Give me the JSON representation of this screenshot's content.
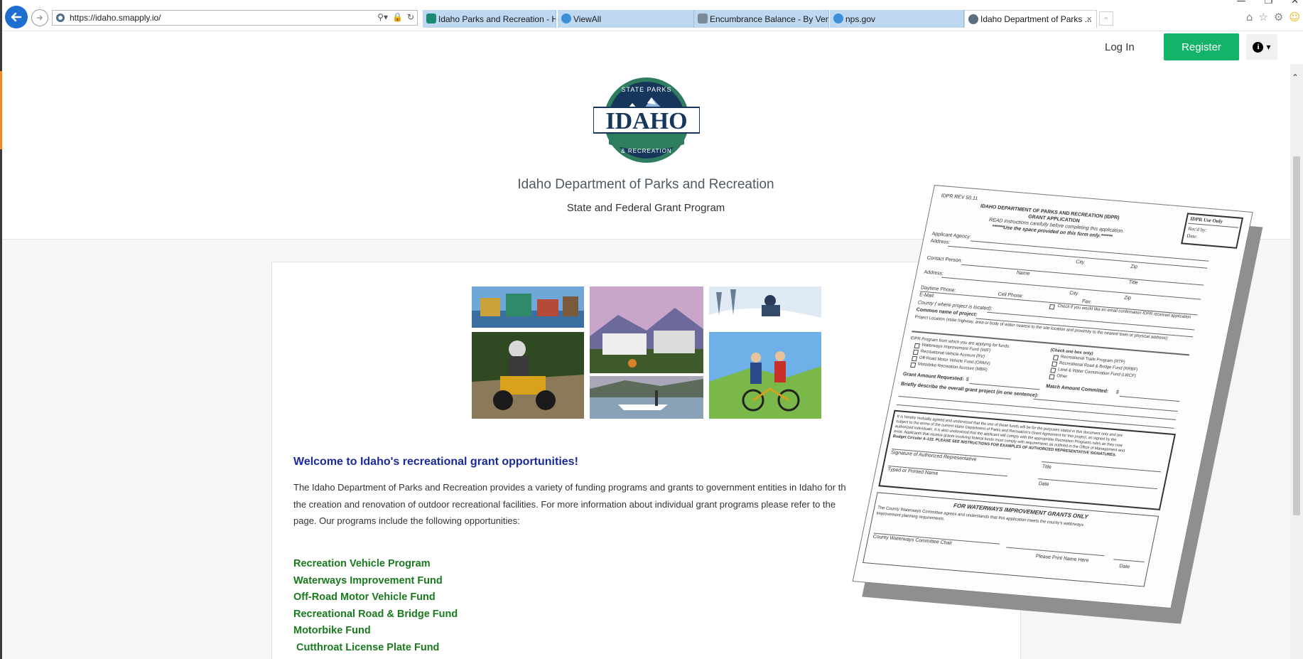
{
  "browser": {
    "url": "https://idaho.smapply.io/",
    "tabs": [
      {
        "label": "Idaho Parks and Recreation - H...",
        "icon": "sharepoint-icon"
      },
      {
        "label": "ViewAll",
        "icon": "ie-icon"
      },
      {
        "label": "Encumbrance Balance - By Ven...",
        "icon": "report-icon"
      },
      {
        "label": "nps.gov",
        "icon": "ie-icon"
      },
      {
        "label": "Idaho Department of Parks ...",
        "icon": "smapply-icon",
        "active": true
      }
    ],
    "close_glyph": "×"
  },
  "header": {
    "login_label": "Log In",
    "register_label": "Register",
    "info_glyph": "i"
  },
  "org": {
    "logo_text": "IDAHO",
    "logo_top_ring": "STATE PARKS",
    "logo_bottom_ring": "& RECREATION",
    "title": "Idaho Department of Parks and Recreation",
    "subtitle": "State and Federal Grant Program"
  },
  "content": {
    "welcome": "Welcome to Idaho's recreational grant opportunities!",
    "intro_line1": "The Idaho Department of Parks and Recreation provides a variety of funding programs and grants to government entities in Idaho for th",
    "intro_line2": "the creation and renovation of outdoor recreational facilities. For more information about individual grant programs please refer to the",
    "intro_line3": "page. Our programs include the following opportunities:",
    "programs": [
      "Recreation Vehicle Program",
      "Waterways Improvement Fund",
      "Off-Road Motor Vehicle Fund",
      "Recreational Road & Bridge Fund",
      "Motorbike Fund",
      "Cutthroat License Plate Fund"
    ]
  },
  "form": {
    "rev": "IDPR REV 50.11",
    "title": "IDAHO DEPARTMENT OF PARKS AND RECREATION (IDPR)",
    "subtitle": "GRANT APPLICATION",
    "read_note": "READ instructions carefully before completing this application.",
    "space_note": "******Use the space provided on this form only.******",
    "use_only": "IDPR Use Only",
    "recd_by": "Rec'd by:",
    "date_short": "Date:",
    "applicant_agency": "Applicant Agency:",
    "address": "Address:",
    "city": "City",
    "zip": "Zip",
    "contact_person": "Contact Person:",
    "name": "Name",
    "title_lbl": "Title",
    "daytime_phone": "Daytime Phone:",
    "cell_phone": "Cell Phone:",
    "fax": "Fax:",
    "email": "E-Mail:",
    "email_check": "Check if you would like an email confirmation IDPR received application",
    "county": "County ( where project is located):",
    "common_name": "Common name of project:",
    "project_location": "Project Location (state highway, area or body of water nearest to the site location and proximity to the nearest town or physical address):",
    "program_header": "IDPR Program from which you are applying for funds:",
    "check_one": "(Check one box only)",
    "left_programs": [
      "Waterways Improvement Fund (WIF)",
      "Recreational Vehicle Account (RV)",
      "Off-Road Motor Vehicle Fund (ORMV)",
      "Motorbike Recreation Account (MBR)"
    ],
    "right_programs": [
      "Recreational Trails Program (RTP)",
      "Recreational Road & Bridge Fund (RRBF)",
      "Land & Water Conservation Fund (LWCF)",
      "Other"
    ],
    "grant_requested": "Grant Amount Requested:",
    "match_committed": "Match Amount Committed:",
    "dollar": "$",
    "briefly": "Briefly describe the overall grant project (in one sentence):",
    "agreement_1": "It is hereby mutually agreed and understood that the use of these funds will be for the purposes stated in this document only and are",
    "agreement_2": "subject to the terms of the current Idaho Department of Parks and Recreation's Grant Agreement for this project, as signed by the",
    "agreement_3": "authorized individuals. It is also understood that the applicant will comply with the appropriate Recreation Programs rules as they now",
    "agreement_4": "exist. Applicants that receive grants involving federal funds must comply with requirements as outlined in the Office of Management and",
    "agreement_5": "Budget Circular A-133. PLEASE SEE INSTRUCTIONS FOR EXAMPLES OF AUTHORIZED REPRESENTATIVE SIGNATURES.",
    "sig_rep": "Signature of Authorized Representative",
    "typed_name": "Typed or Printed Name",
    "title_sig": "Title",
    "date_sig": "Date",
    "waterways_header": "FOR WATERWAYS IMPROVEMENT GRANTS ONLY",
    "waterways_text_1": "The County Waterways Committee agrees and understands that this application meets the county's waterways",
    "waterways_text_2": "improvement planning requirements.",
    "committee_chair": "County Waterways Committee Chair",
    "print_name": "Please Print Name Here",
    "date_final": "Date"
  },
  "colors": {
    "register_bg": "#13b36a",
    "welcome_text": "#1a2a9a",
    "program_text": "#1a7a1e",
    "back_button": "#1e6fd0",
    "tab_bg": "#bdd8f0"
  }
}
